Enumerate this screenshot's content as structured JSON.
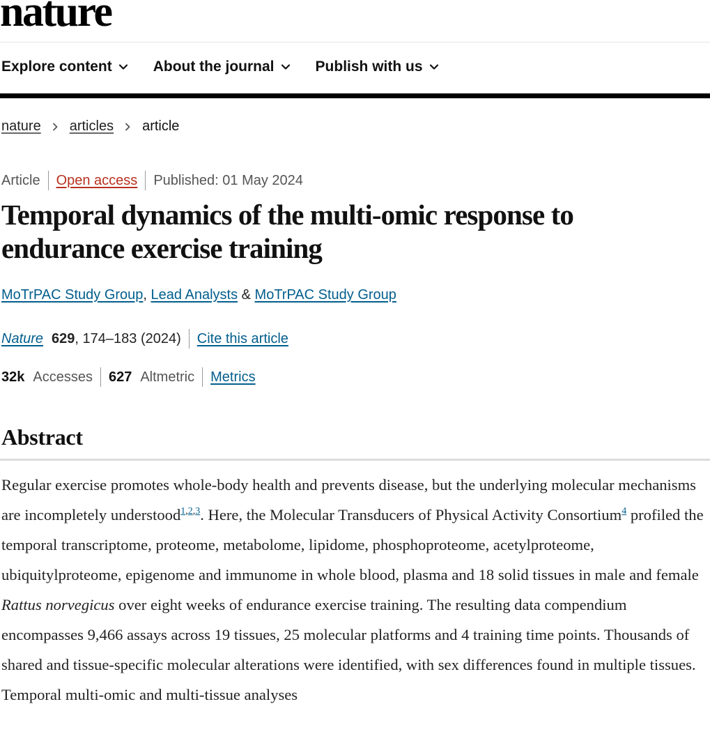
{
  "header": {
    "logo_text": "nature"
  },
  "nav": {
    "items": [
      {
        "label": "Explore content"
      },
      {
        "label": "About the journal"
      },
      {
        "label": "Publish with us"
      }
    ]
  },
  "breadcrumb": {
    "items": [
      {
        "label": "nature"
      },
      {
        "label": "articles"
      },
      {
        "label": "article"
      }
    ]
  },
  "article": {
    "type": "Article",
    "access": "Open access",
    "published": "Published: 01 May 2024",
    "title": "Temporal dynamics of the multi-omic response to endurance exercise training",
    "authors": [
      {
        "name": "MoTrPAC Study Group"
      },
      {
        "name": "Lead Analysts"
      },
      {
        "name": "MoTrPAC Study Group"
      }
    ],
    "author_sep_1": ",",
    "author_sep_2": "&",
    "citation": {
      "journal": "Nature",
      "volume": "629",
      "pages_year": ", 174–183 (2024)",
      "cite_label": "Cite this article"
    },
    "metrics": {
      "accesses_value": "32k",
      "accesses_label": "Accesses",
      "altmetric_value": "627",
      "altmetric_label": "Altmetric",
      "metrics_link": "Metrics"
    }
  },
  "abstract": {
    "heading": "Abstract",
    "part1": "Regular exercise promotes whole-body health and prevents disease, but the underlying molecular mechanisms are incompletely understood",
    "refs1": [
      "1",
      "2",
      "3"
    ],
    "part2": ". Here, the Molecular Transducers of Physical Activity Consortium",
    "ref4": "4",
    "part3": " profiled the temporal transcriptome, proteome, metabolome, lipidome, phosphoproteome, acetylproteome, ubiquitylproteome, epigenome and immunome in whole blood, plasma and 18 solid tissues in male and female ",
    "species": "Rattus norvegicus",
    "part4": " over eight weeks of endurance exercise training. The resulting data compendium encompasses 9,466 assays across 19 tissues, 25 molecular platforms and 4 training time points. Thousands of shared and tissue-specific molecular alterations were identified, with sex differences found in multiple tissues. Temporal multi-omic and multi-tissue analyses"
  },
  "colors": {
    "link_blue": "#025e8d",
    "open_access_red": "#b8311f",
    "text": "#222222"
  }
}
